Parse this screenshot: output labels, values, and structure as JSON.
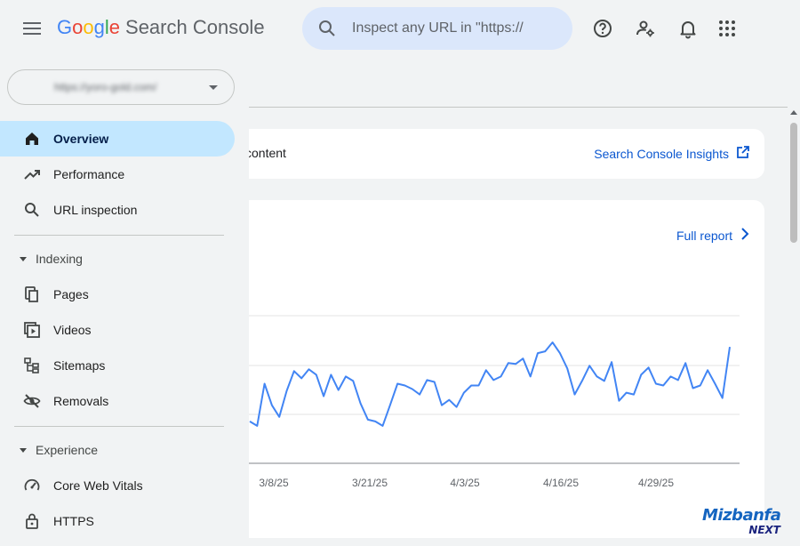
{
  "header": {
    "logo_letters": [
      "G",
      "o",
      "o",
      "g",
      "l",
      "e"
    ],
    "product_name": "Search Console",
    "search_placeholder": "Inspect any URL in \"https://",
    "icons": [
      "menu-icon",
      "search-icon",
      "help-icon",
      "manage-users-icon",
      "notifications-icon",
      "apps-icon"
    ]
  },
  "sidebar": {
    "property_url": "https://yoro-gold.com/",
    "nav": [
      {
        "label": "Overview",
        "icon": "home-icon",
        "active": true
      },
      {
        "label": "Performance",
        "icon": "trending-up-icon",
        "active": false
      },
      {
        "label": "URL inspection",
        "icon": "search-icon",
        "active": false
      }
    ],
    "sections": [
      {
        "label": "Indexing",
        "items": [
          {
            "label": "Pages",
            "icon": "pages-icon"
          },
          {
            "label": "Videos",
            "icon": "video-icon"
          },
          {
            "label": "Sitemaps",
            "icon": "sitemap-icon"
          },
          {
            "label": "Removals",
            "icon": "visibility-off-icon"
          }
        ]
      },
      {
        "label": "Experience",
        "items": [
          {
            "label": "Core Web Vitals",
            "icon": "speed-icon"
          },
          {
            "label": "HTTPS",
            "icon": "lock-icon"
          }
        ]
      }
    ]
  },
  "main": {
    "insights_card": {
      "text_fragment": "content",
      "link_label": "Search Console Insights"
    },
    "performance_card": {
      "link_label": "Full report"
    }
  },
  "chart_data": {
    "type": "line",
    "x_tick_labels": [
      "3/8/25",
      "3/21/25",
      "4/3/25",
      "4/16/25",
      "4/29/25"
    ],
    "series": [
      {
        "color": "#4285f4",
        "values": [
          0.1,
          0.05,
          0.52,
          0.28,
          0.15,
          0.44,
          0.66,
          0.58,
          0.68,
          0.62,
          0.38,
          0.62,
          0.45,
          0.6,
          0.55,
          0.3,
          0.12,
          0.1,
          0.05,
          0.28,
          0.52,
          0.5,
          0.46,
          0.4,
          0.56,
          0.54,
          0.28,
          0.34,
          0.26,
          0.42,
          0.5,
          0.5,
          0.67,
          0.56,
          0.6,
          0.75,
          0.74,
          0.8,
          0.6,
          0.86,
          0.88,
          0.98,
          0.86,
          0.69,
          0.4,
          0.55,
          0.72,
          0.6,
          0.55,
          0.76,
          0.33,
          0.42,
          0.4,
          0.62,
          0.7,
          0.52,
          0.5,
          0.6,
          0.56,
          0.75,
          0.47,
          0.5,
          0.67,
          0.52,
          0.36,
          0.93
        ]
      }
    ],
    "grid": true,
    "ylim": [
      0,
      1
    ]
  },
  "watermark": {
    "line1": "Mizbanfa",
    "line2": "NEXT"
  }
}
